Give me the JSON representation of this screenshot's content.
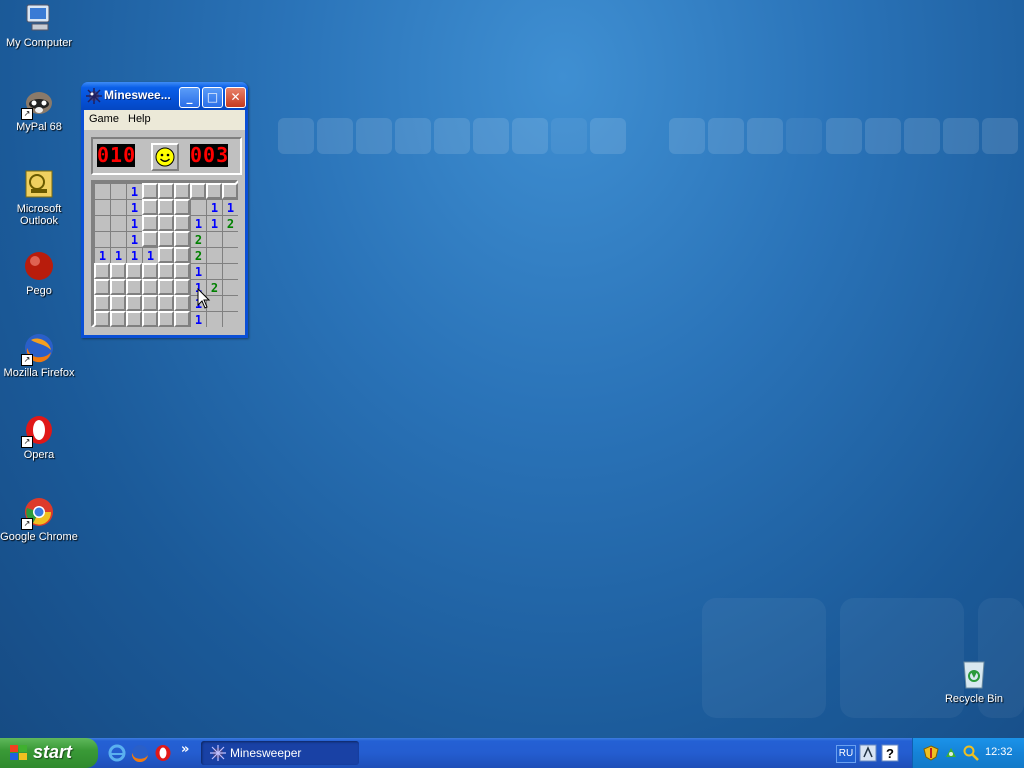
{
  "desktop": {
    "icons": [
      {
        "label": "My Computer"
      },
      {
        "label": "MyPal 68"
      },
      {
        "label": "Microsoft Outlook"
      },
      {
        "label": "Pego"
      },
      {
        "label": "Mozilla Firefox"
      },
      {
        "label": "Opera"
      },
      {
        "label": "Google Chrome"
      }
    ],
    "recycle_bin": {
      "label": "Recycle Bin"
    }
  },
  "window": {
    "title": "Minesweе...",
    "menu": {
      "game": "Game",
      "help": "Help"
    },
    "mines_counter": "010",
    "timer": "003",
    "face": "smiley",
    "board": {
      "rows": 9,
      "cols": 9,
      "cells": [
        "..1UUUUUU",
        "..1UUU.11",
        "..1UUU112",
        "..1UUU2..",
        "1111UU2..",
        "UUUUUU1..",
        "UUUUUU12.",
        "UUUUUU1..",
        "UUUUUU1.."
      ],
      "number_colors": {
        "1": "#0000ff",
        "2": "#008000"
      }
    },
    "controls": {
      "minimize": "_",
      "maximize": "□",
      "close": "✕"
    }
  },
  "taskbar": {
    "start_label": "start",
    "active_task": "Minesweeper",
    "language": "RU",
    "clock": "12:32",
    "overflow": "»"
  }
}
